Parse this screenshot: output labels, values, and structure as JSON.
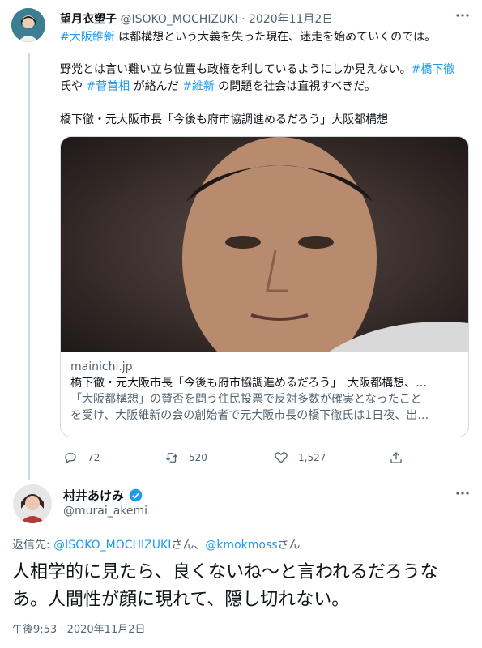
{
  "post1": {
    "display_name": "望月衣塑子",
    "handle": "@ISOKO_MOCHIZUKI",
    "separator": "·",
    "date": "2020年11月2日",
    "line1": {
      "hashtag": "#大阪維新",
      "text": " は都構想という大義を失った現在、迷走を始めていくのでは。"
    },
    "line2": {
      "text_a": "野党とは言い難い立ち位置も政権を利しているようにしか見えない。",
      "hashtag_a": "#橋下徹",
      "text_b": " 氏や ",
      "hashtag_b": "#菅首相",
      "text_c": " が絡んだ ",
      "hashtag_c": "#維新",
      "text_d": " の問題を社会は直視すべきだ。"
    },
    "line3": "橋下徹・元大阪市長「今後も府市協調進めるだろう」大阪都構想",
    "card": {
      "domain": "mainichi.jp",
      "title": "橋下徹・元大阪市長「今後も府市協調進めるだろう」　大阪都構想、…",
      "desc1": "「大阪都構想」の賛否を問う住民投票で反対多数が確実となったこと",
      "desc2": "を受け、大阪維新の会の創始者で元大阪市長の橋下徹氏は1日夜、出…"
    },
    "actions": {
      "replies": "72",
      "retweets": "520",
      "likes": "1,527"
    }
  },
  "post2": {
    "display_name": "村井あけみ",
    "handle": "@murai_akemi",
    "reply_label": "返信先: ",
    "reply_user1": "@ISOKO_MOCHIZUKI",
    "reply_san1": "さん、",
    "reply_user2": "@kmokmoss",
    "reply_san2": "さん",
    "text_line1": "人相学的に見たら、良くないね〜と言われるだろうな",
    "text_line2": "あ。人間性が顔に現れて、隠し切れない。",
    "timestamp": "午後9:53 · 2020年11月2日"
  },
  "colors": {
    "accent": "#1d9bf0",
    "muted": "#536471",
    "border": "#cfd9de"
  },
  "icons": [
    "more-icon",
    "reply-icon",
    "retweet-icon",
    "like-icon",
    "share-icon",
    "verified-badge-icon"
  ]
}
